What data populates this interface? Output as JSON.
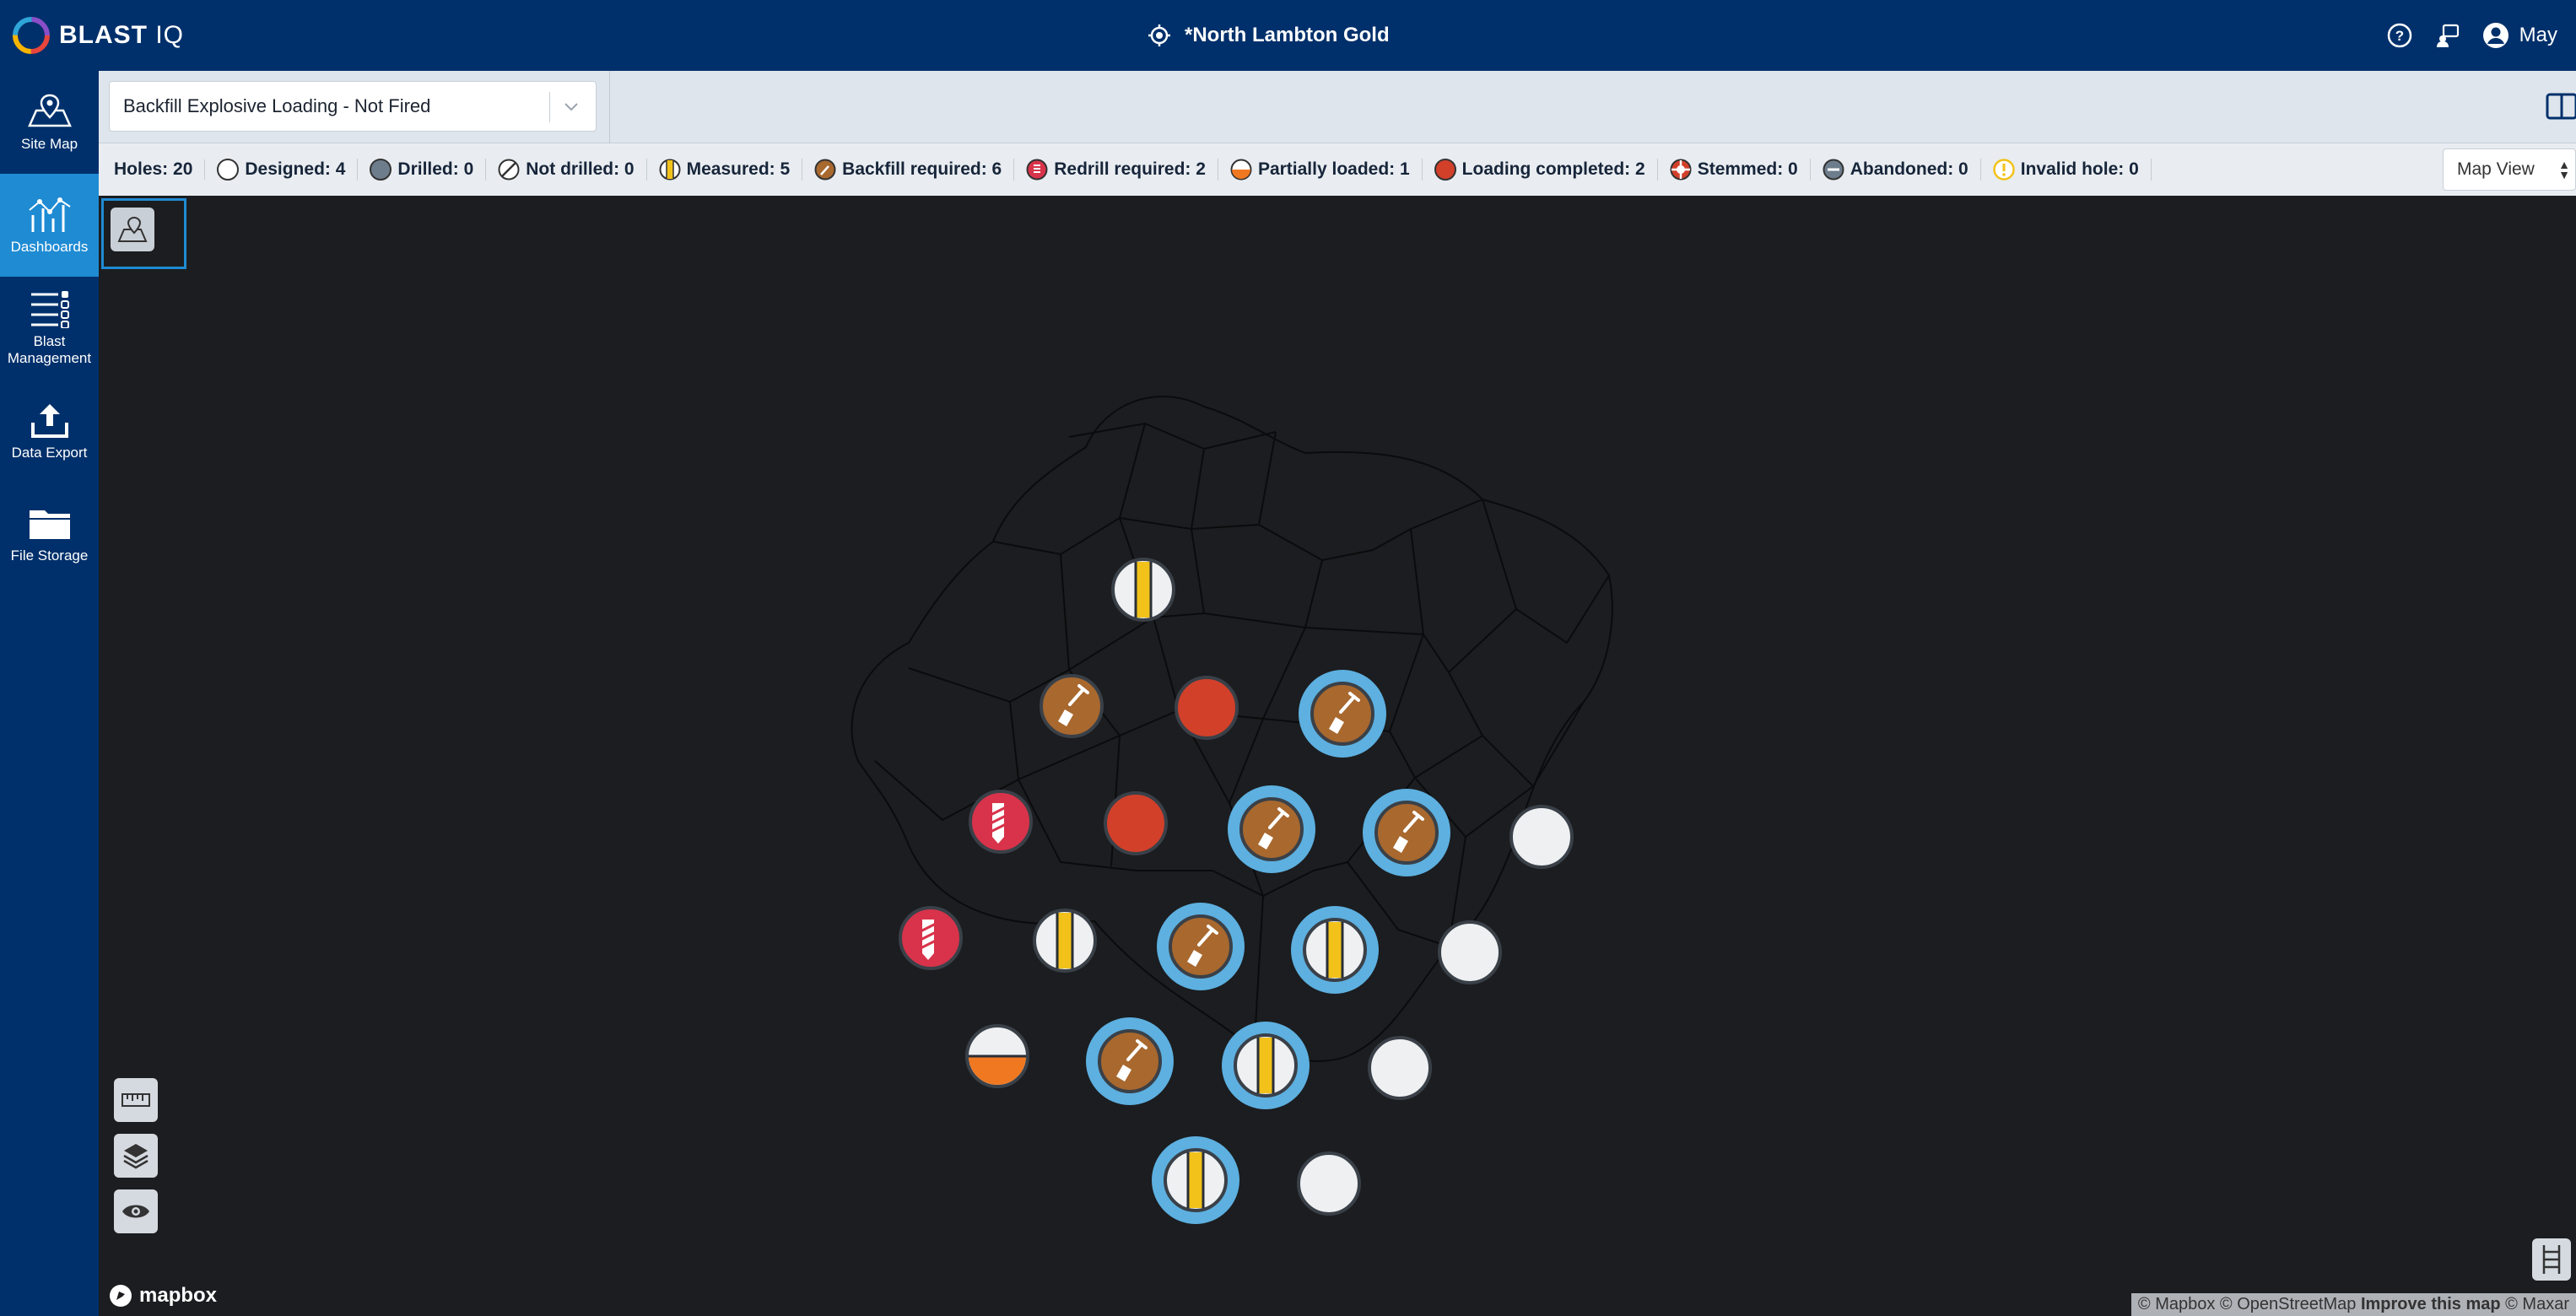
{
  "app": {
    "logo_text": "BLAST",
    "logo_suffix": "IQ",
    "site_title": "*North Lambton Gold",
    "user_name": "May"
  },
  "nav": [
    {
      "label": "Site Map",
      "icon": "map-pin-icon"
    },
    {
      "label": "Dashboards",
      "icon": "chart-icon",
      "active": true
    },
    {
      "label": "Blast Management",
      "icon": "list-settings-icon"
    },
    {
      "label": "Data Export",
      "icon": "upload-icon"
    },
    {
      "label": "File Storage",
      "icon": "folder-icon"
    }
  ],
  "toolbar": {
    "dropdown_value": "Backfill Explosive Loading - Not Fired"
  },
  "legend": {
    "holes": "Holes: 20",
    "items": [
      {
        "label": "Designed: 4",
        "icon": "designed-icon"
      },
      {
        "label": "Drilled: 0",
        "icon": "drilled-icon"
      },
      {
        "label": "Not drilled: 0",
        "icon": "not-drilled-icon"
      },
      {
        "label": "Measured: 5",
        "icon": "measured-icon"
      },
      {
        "label": "Backfill required: 6",
        "icon": "backfill-icon"
      },
      {
        "label": "Redrill required: 2",
        "icon": "redrill-icon"
      },
      {
        "label": "Partially loaded: 1",
        "icon": "partially-loaded-icon"
      },
      {
        "label": "Loading completed: 2",
        "icon": "loading-completed-icon"
      },
      {
        "label": "Stemmed: 0",
        "icon": "stemmed-icon"
      },
      {
        "label": "Abandoned: 0",
        "icon": "abandoned-icon"
      },
      {
        "label": "Invalid hole: 0",
        "icon": "invalid-hole-icon"
      }
    ],
    "view_select": "Map View"
  },
  "colors": {
    "header": "#00306b",
    "active_nav": "#1f8bd3",
    "designed": "#eef0f2",
    "backfill": "#a8682e",
    "loaded": "#d2402a",
    "redrill": "#d8334a",
    "measured_stripe": "#f2c21a",
    "partial": "#f07820",
    "selected_ring": "#5db0e0"
  },
  "map": {
    "mapbox_label": "mapbox",
    "attribution": "© Mapbox © OpenStreetMap",
    "attribution_link": "Improve this map",
    "attribution_tail": "© Maxar"
  },
  "holes": [
    {
      "status": "measured",
      "selected": false
    },
    {
      "status": "backfill",
      "selected": false
    },
    {
      "status": "loading_completed",
      "selected": false
    },
    {
      "status": "backfill",
      "selected": true
    },
    {
      "status": "redrill",
      "selected": false
    },
    {
      "status": "loading_completed",
      "selected": false
    },
    {
      "status": "backfill",
      "selected": true
    },
    {
      "status": "backfill",
      "selected": true
    },
    {
      "status": "designed",
      "selected": false
    },
    {
      "status": "redrill",
      "selected": false
    },
    {
      "status": "measured",
      "selected": false
    },
    {
      "status": "backfill",
      "selected": true
    },
    {
      "status": "measured",
      "selected": true
    },
    {
      "status": "designed",
      "selected": false
    },
    {
      "status": "partially_loaded",
      "selected": false
    },
    {
      "status": "backfill",
      "selected": true
    },
    {
      "status": "measured",
      "selected": true
    },
    {
      "status": "designed",
      "selected": false
    },
    {
      "status": "measured",
      "selected": true
    },
    {
      "status": "designed",
      "selected": false
    }
  ]
}
